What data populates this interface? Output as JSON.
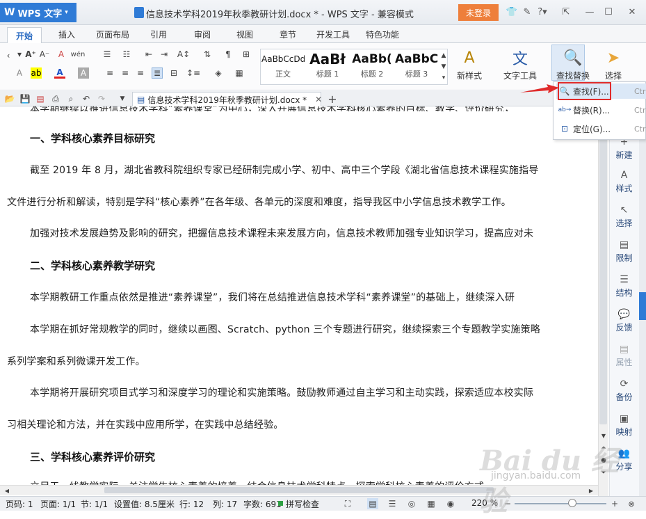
{
  "app": {
    "name": "WPS 文字",
    "title": "信息技术学科2019年秋季教研计划.docx * - WPS 文字 - 兼容模式",
    "login": "未登录"
  },
  "tabs": [
    "开始",
    "插入",
    "页面布局",
    "引用",
    "审阅",
    "视图",
    "章节",
    "开发工具",
    "特色功能"
  ],
  "styles": [
    {
      "preview": "AaBbCcDd",
      "label": "正文"
    },
    {
      "preview": "AaBł",
      "label": "标题 1"
    },
    {
      "preview": "AaBb(",
      "label": "标题 2"
    },
    {
      "preview": "AaBbC",
      "label": "标题 3"
    }
  ],
  "ribbon": {
    "new_style": "新样式",
    "text_tools": "文字工具",
    "find_replace": "查找替换",
    "select": "选择"
  },
  "doc_tab": {
    "name": "信息技术学科2019年秋季教研计划.docx *"
  },
  "menu": {
    "find": {
      "label": "查找(F)...",
      "key": "Ctr"
    },
    "replace": {
      "label": "替换(R)...",
      "key": "Ctr"
    },
    "goto": {
      "label": "定位(G)...",
      "key": "Ctr"
    }
  },
  "document": {
    "top_fragment": "本学期继续以推进信息技术学科“素养课堂”为中心，深入开展信息技术学科核心素养的目标、教学、评价研究，",
    "h1": "一、学科核心素养目标研究",
    "p1a": "截至 2019 年 8 月，湖北省教科院组织专家已经研制完成小学、初中、高中三个学段《湖北省信息技术课程实施指导",
    "p1b": "文件进行分析和解读，特别是学科“核心素养”在各年级、各单元的深度和难度，指导我区中小学信息技术教学工作。",
    "p2": "加强对技术发展趋势及影响的研究，把握信息技术课程未来发展方向，信息技术教师加强专业知识学习，提高应对未",
    "h2": "二、学科核心素养教学研究",
    "p3": "本学期教研工作重点依然是推进“素养课堂”，我们将在总结推进信息技术学科“素养课堂”的基础上，继续深入研",
    "p4a": "本学期在抓好常规教学的同时，继续以画图、Scratch、python 三个专题进行研究，继续探索三个专题教学实施策略",
    "p4b": "系列学案和系列微课开发工作。",
    "p5a": "本学期将开展研究项目式学习和深度学习的理论和实施策略。鼓励教师通过自主学习和主动实践，探索适应本校实际",
    "p5b": "习相关理论和方法，并在实践中应用所学，在实践中总结经验。",
    "h3": "三、学科核心素养评价研究",
    "bottom_fragment": "立足于一线教学实际，关注学生核心素养的培养，结合信息技术学科特点，探索学科核心素养的评价方式，"
  },
  "side_panel": [
    "新建",
    "样式",
    "选择",
    "限制",
    "结构",
    "反馈",
    "属性",
    "备份",
    "映射",
    "分享"
  ],
  "status": {
    "page": "页码: 1",
    "pages": "页面: 1/1",
    "section": "节: 1/1",
    "setting": "设置值: 8.5厘米",
    "row": "行: 12",
    "col": "列: 17",
    "words": "字数: 691",
    "spell": "拼写检查",
    "zoom": "220 %"
  },
  "watermark": {
    "brand": "Bai du 经验",
    "url": "jingyan.baidu.com"
  }
}
